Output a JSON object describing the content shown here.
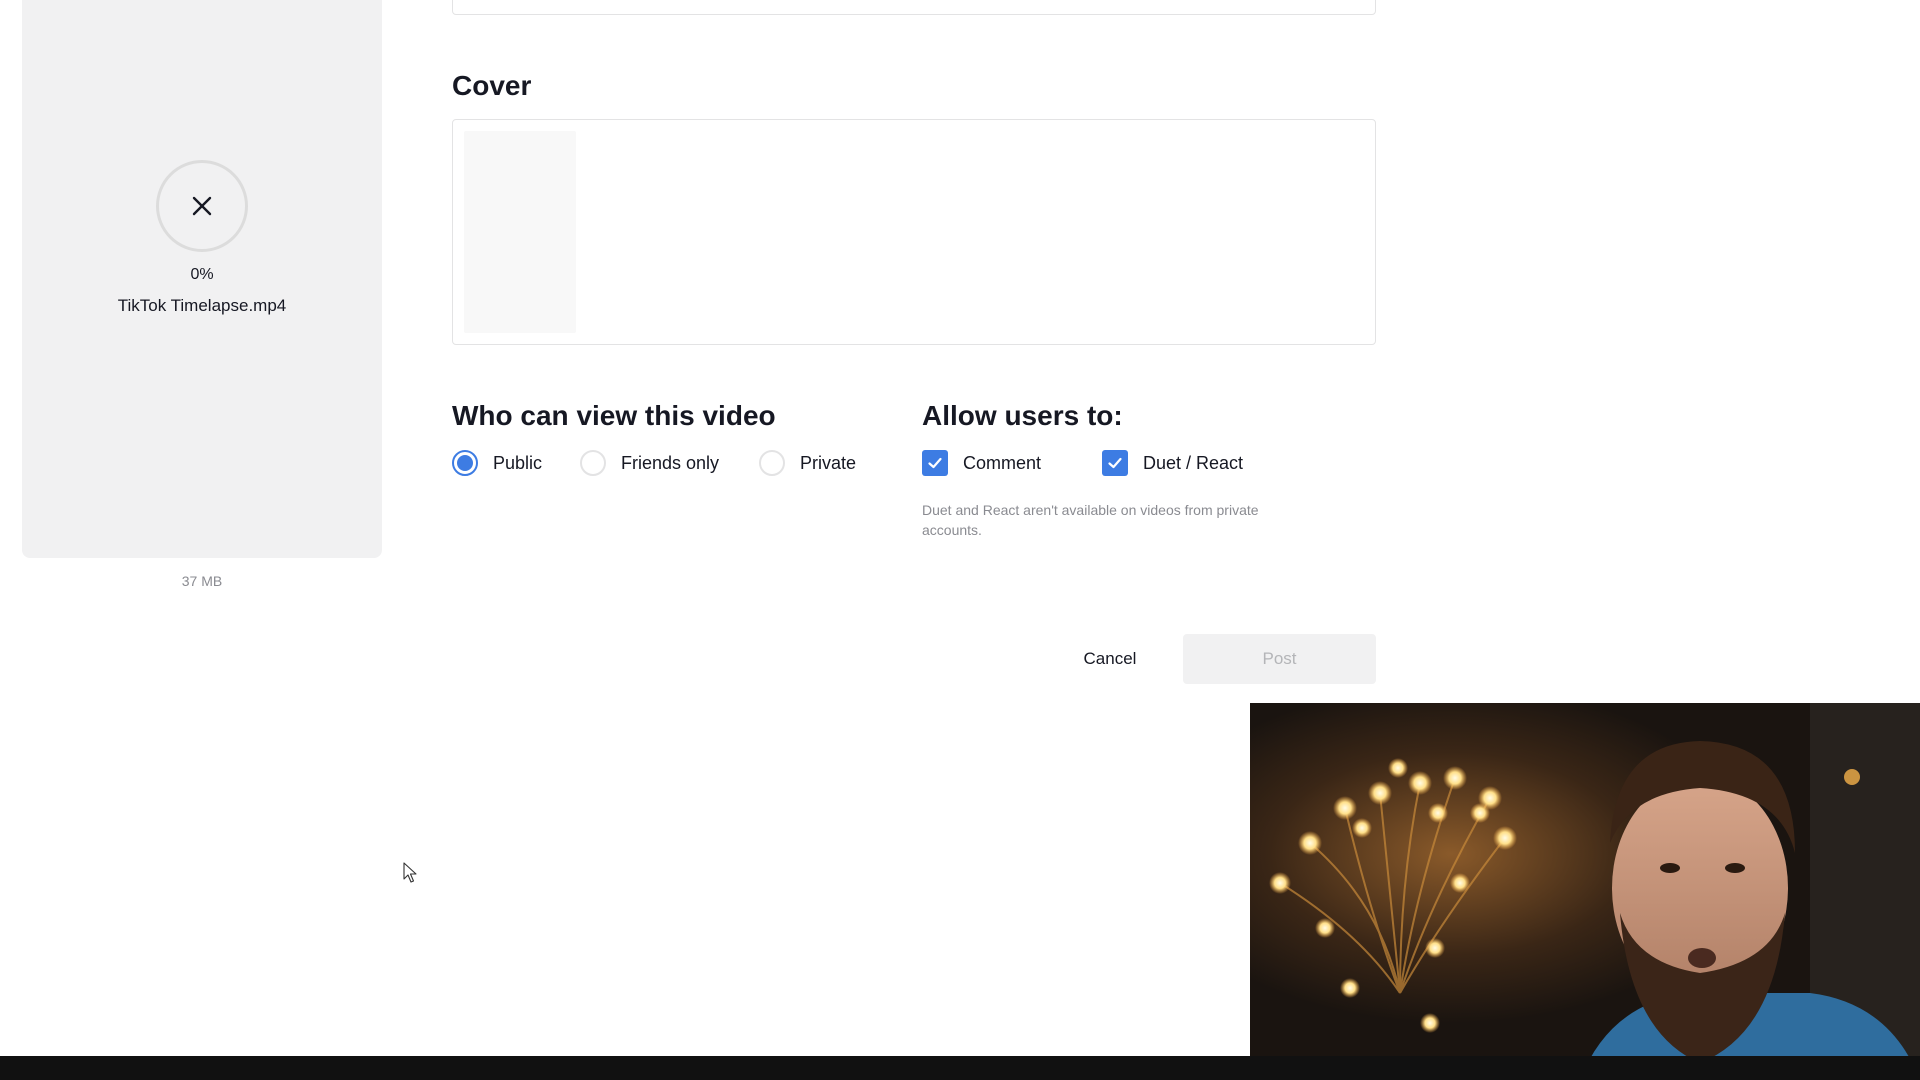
{
  "upload": {
    "progress": "0%",
    "filename": "TikTok Timelapse.mp4",
    "filesize": "37 MB"
  },
  "cover": {
    "title": "Cover"
  },
  "privacy": {
    "title": "Who can view this video",
    "options": [
      {
        "label": "Public",
        "selected": true
      },
      {
        "label": "Friends only",
        "selected": false
      },
      {
        "label": "Private",
        "selected": false
      }
    ]
  },
  "permissions": {
    "title": "Allow users to:",
    "options": [
      {
        "label": "Comment",
        "checked": true
      },
      {
        "label": "Duet / React",
        "checked": true
      }
    ],
    "note": "Duet and React aren't available on videos from private accounts."
  },
  "actions": {
    "cancel_label": "Cancel",
    "post_label": "Post"
  },
  "colors": {
    "accent": "#3d7ce3",
    "panel_bg": "#f1f1f2",
    "text": "#161823",
    "muted": "#8a8b91"
  }
}
